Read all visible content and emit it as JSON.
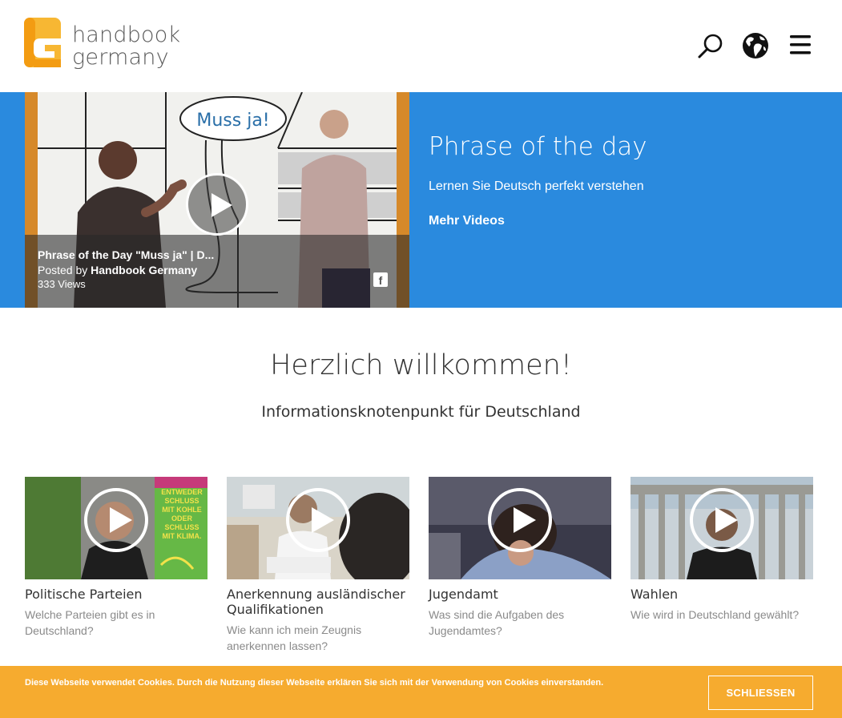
{
  "header": {
    "logo_line1": "handbook",
    "logo_line2": "germany",
    "logo_icon": "handbook-g-logo",
    "icons": [
      "search-icon",
      "globe-icon",
      "hamburger-menu-icon"
    ]
  },
  "hero": {
    "video": {
      "speech_bubble": "Muss ja!",
      "title": "Phrase of the Day \"Muss ja\" | D...",
      "posted_prefix": "Posted by",
      "posted_by": "Handbook Germany",
      "views": "333 Views",
      "share_icon": "facebook-icon"
    },
    "title": "Phrase of the day",
    "subtitle": "Lernen Sie Deutsch perfekt verstehen",
    "more_link": "Mehr Videos"
  },
  "welcome": {
    "title": "Herzlich willkommen!",
    "subtitle": "Informationsknotenpunkt für Deutschland"
  },
  "cards": [
    {
      "title": "Politische Parteien",
      "desc": "Welche Parteien gibt es in Deutschland?",
      "poster_text": [
        "ENTWEDER",
        "SCHLUSS",
        "MIT KOHLE",
        "ODER",
        "SCHLUSS",
        "MIT KLIMA."
      ]
    },
    {
      "title": "Anerkennung ausländischer Qualifikationen",
      "desc": "Wie kann ich mein Zeugnis anerkennen lassen?"
    },
    {
      "title": "Jugendamt",
      "desc": "Was sind die Aufgaben des Jugendamtes?"
    },
    {
      "title": "Wahlen",
      "desc": "Wie wird in Deutschland gewählt?"
    }
  ],
  "cookie": {
    "text": "Diese Webseite verwendet Cookies. Durch die Nutzung dieser Webseite erklären Sie sich mit der Verwendung von Cookies einverstanden.",
    "button": "SCHLIESSEN"
  },
  "colors": {
    "hero_blue": "#2a8ade",
    "video_frame_orange": "#d6892a",
    "cookie_orange": "#f6ab2f",
    "logo_orange": "#f39c12",
    "logo_yellow": "#f7b733"
  }
}
